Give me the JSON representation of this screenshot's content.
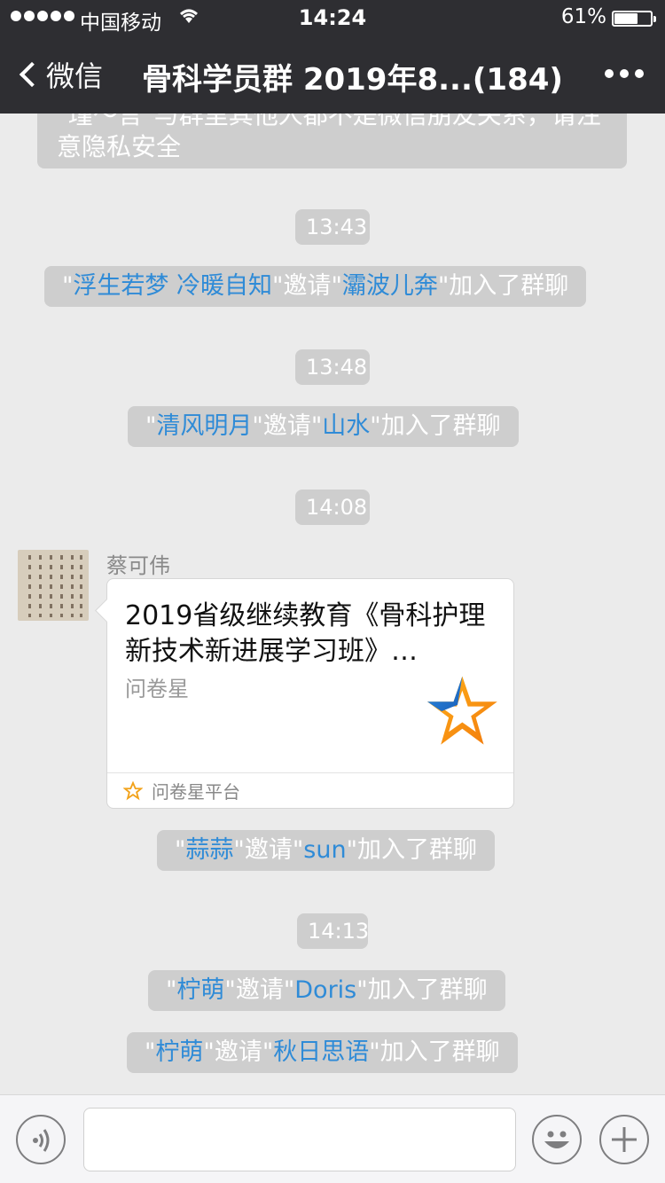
{
  "status_bar": {
    "carrier": "中国移动",
    "time": "14:24",
    "battery": "61%",
    "battery_level": 0.61
  },
  "nav": {
    "back_label": "微信",
    "title": "骨科学员群 2019年8...(184)"
  },
  "chat": {
    "notice_partial": "\"瑾～言\"与群里其他人都不是微信朋友关系，请注意隐私安全",
    "notice_line1": "\"瑾～言\"与群里其他人都不是微信朋友关系，请注",
    "notice_line2": "意隐私安全",
    "timestamps": [
      "13:43",
      "13:48",
      "14:08",
      "14:13"
    ],
    "invite_label": "邀请",
    "joined_label": "加入了群聊",
    "events": [
      {
        "inviter": "浮生若梦  冷暖自知",
        "invitee": "灞波儿奔"
      },
      {
        "inviter": "清风明月",
        "invitee": "山水"
      },
      {
        "inviter": "蒜蒜",
        "invitee": "sun"
      },
      {
        "inviter": "柠萌",
        "invitee": "Doris"
      },
      {
        "inviter": "柠萌",
        "invitee": "秋日思语"
      }
    ],
    "message": {
      "sender": "蔡可伟",
      "card_title": "2019省级继续教育《骨科护理新技术新进展学习班》…",
      "card_source": "问卷星",
      "card_platform": "问卷星平台"
    }
  },
  "colors": {
    "header_bg": "#2e2e32",
    "chat_bg": "#ebebeb",
    "system_bubble": "#cecece",
    "link_blue": "#2f8bd7"
  }
}
